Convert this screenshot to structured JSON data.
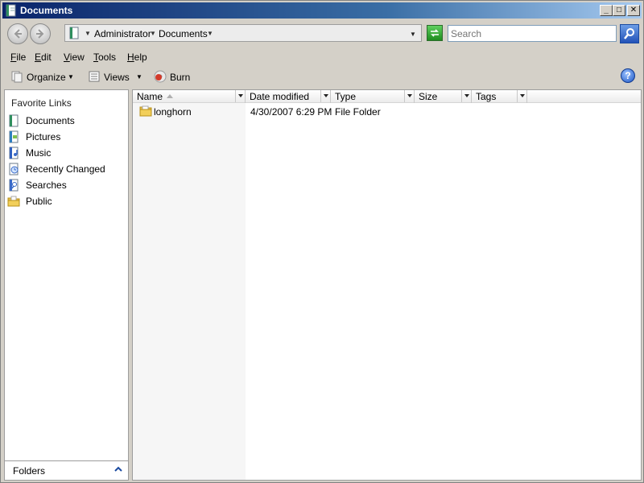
{
  "window": {
    "title": "Documents"
  },
  "caption_buttons": {
    "minimize": "_",
    "maximize": "□",
    "close": "✕"
  },
  "address": {
    "crumbs": [
      "Administrator",
      "Documents"
    ]
  },
  "search": {
    "placeholder": "Search"
  },
  "menu": {
    "items": [
      {
        "label": "File",
        "accel": "F"
      },
      {
        "label": "Edit",
        "accel": "E"
      },
      {
        "label": "View",
        "accel": "V"
      },
      {
        "label": "Tools",
        "accel": "T"
      },
      {
        "label": "Help",
        "accel": "H"
      }
    ]
  },
  "commands": {
    "organize": "Organize",
    "views": "Views",
    "burn": "Burn",
    "help": "?"
  },
  "nav": {
    "title": "Favorite Links",
    "links": [
      {
        "label": "Documents",
        "icon": "documents-icon"
      },
      {
        "label": "Pictures",
        "icon": "pictures-icon"
      },
      {
        "label": "Music",
        "icon": "music-icon"
      },
      {
        "label": "Recently Changed",
        "icon": "recently-changed-icon"
      },
      {
        "label": "Searches",
        "icon": "searches-icon"
      },
      {
        "label": "Public",
        "icon": "public-folder-icon"
      }
    ],
    "folders_label": "Folders"
  },
  "list": {
    "columns": [
      "Name",
      "Date modified",
      "Type",
      "Size",
      "Tags"
    ],
    "rows": [
      {
        "name": "longhorn",
        "date": "4/30/2007 6:29 PM",
        "type": "File Folder",
        "size": "",
        "tags": ""
      }
    ]
  },
  "colors": {
    "title_gradient_start": "#0a246a",
    "title_gradient_end": "#a6caf0",
    "chrome": "#d4d0c8",
    "refresh_green": "#1e8c1e",
    "search_blue": "#2252b8"
  }
}
